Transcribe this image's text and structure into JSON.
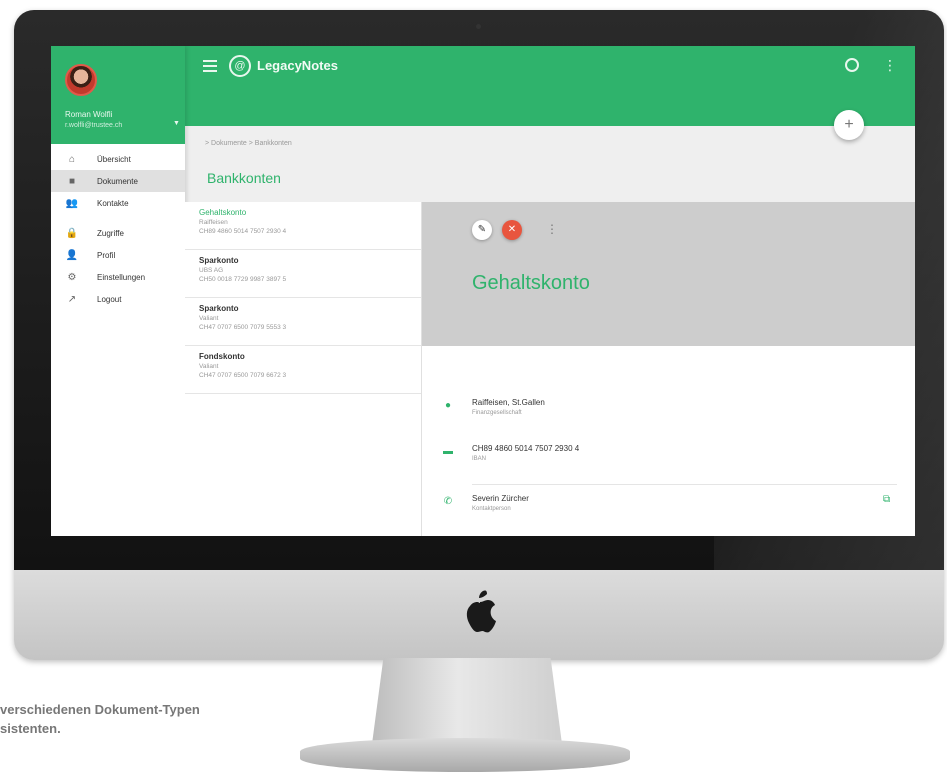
{
  "app": {
    "brand": "LegacyNotes"
  },
  "user": {
    "name": "Roman Wolfli",
    "email": "r.wolfli@trustee.ch"
  },
  "nav": {
    "items": [
      {
        "label": "Übersicht",
        "icon": "home-icon"
      },
      {
        "label": "Dokumente",
        "icon": "folder-icon"
      },
      {
        "label": "Kontakte",
        "icon": "people-icon"
      },
      {
        "label": "Zugriffe",
        "icon": "lock-icon"
      },
      {
        "label": "Profil",
        "icon": "person-icon"
      },
      {
        "label": "Einstellungen",
        "icon": "gear-icon"
      },
      {
        "label": "Logout",
        "icon": "logout-icon"
      }
    ],
    "active_index": 1
  },
  "breadcrumb": "> Dokumente > Bankkonten",
  "page_title": "Bankkonten",
  "accounts": [
    {
      "title": "Gehaltskonto",
      "bank": "Raiffeisen",
      "iban": "CH89 4860 5014 7507 2930 4"
    },
    {
      "title": "Sparkonto",
      "bank": "UBS AG",
      "iban": "CH50 0018 7729 9987 3897 5"
    },
    {
      "title": "Sparkonto",
      "bank": "Valiant",
      "iban": "CH47 0707 6500 7079 5553 3"
    },
    {
      "title": "Fondskonto",
      "bank": "Valiant",
      "iban": "CH47 0707 6500 7079 6672 3"
    }
  ],
  "detail": {
    "title": "Gehaltskonto",
    "fields": [
      {
        "icon": "location-icon",
        "value": "Raiffeisen, St.Gallen",
        "label": "Finanzgesellschaft"
      },
      {
        "icon": "card-icon",
        "value": "CH89 4860 5014 7507 2930 4",
        "label": "IBAN"
      },
      {
        "icon": "phone-icon",
        "value": "Severin Zürcher",
        "label": "Kontaktperson"
      }
    ]
  },
  "caption": {
    "line1": "verschiedenen Dokument-Typen",
    "line2": "sistenten."
  },
  "colors": {
    "accent": "#2fb36c",
    "danger": "#e8553e",
    "hero": "#cdcdcd"
  }
}
